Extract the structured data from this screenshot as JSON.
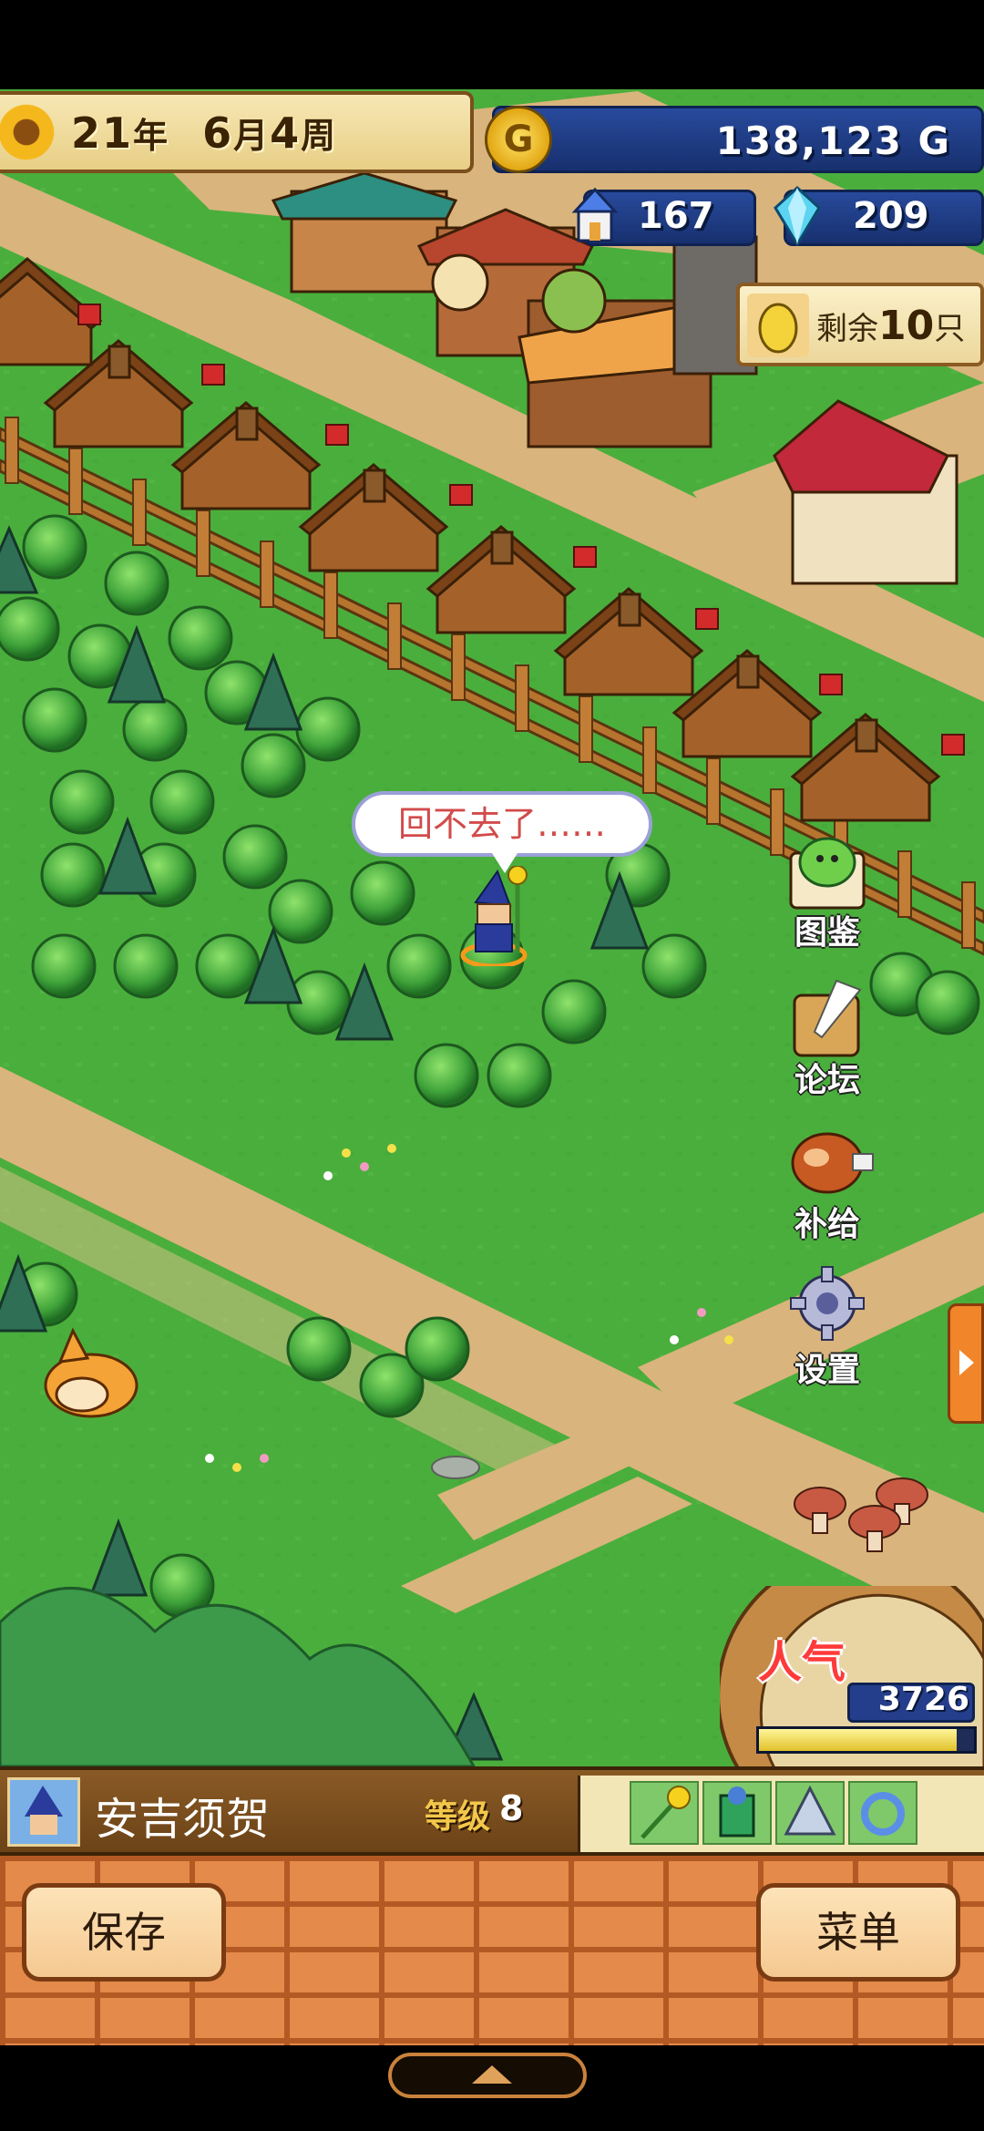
{
  "hud": {
    "year": "21",
    "year_unit": "年",
    "month": "6",
    "month_unit": "月",
    "week": "4",
    "week_unit": "周",
    "money": "138,123 G",
    "coin_symbol": "G",
    "population": "167",
    "gems": "209",
    "remaining_label": "剩余",
    "remaining_count": "10",
    "remaining_unit": "只"
  },
  "side_menu": {
    "encyclopedia": "图鉴",
    "forum": "论坛",
    "supply": "补给",
    "settings": "设置"
  },
  "speech_bubble": "回不去了……",
  "popularity": {
    "label": "人气",
    "value": "3726",
    "meter_fraction": 0.92
  },
  "character": {
    "name": "安吉须贺",
    "level_label": "等级",
    "level": "8",
    "equipment_icons": [
      "sunflower-staff-icon",
      "green-armor-icon",
      "silver-claw-icon",
      "blue-ring-icon"
    ]
  },
  "bottom": {
    "save": "保存",
    "menu": "菜单"
  },
  "colors": {
    "grass": "#4caf3f",
    "path": "#d9b47c",
    "bottom_bar": "#e48a4a",
    "hud_blue": "#253e8b"
  }
}
